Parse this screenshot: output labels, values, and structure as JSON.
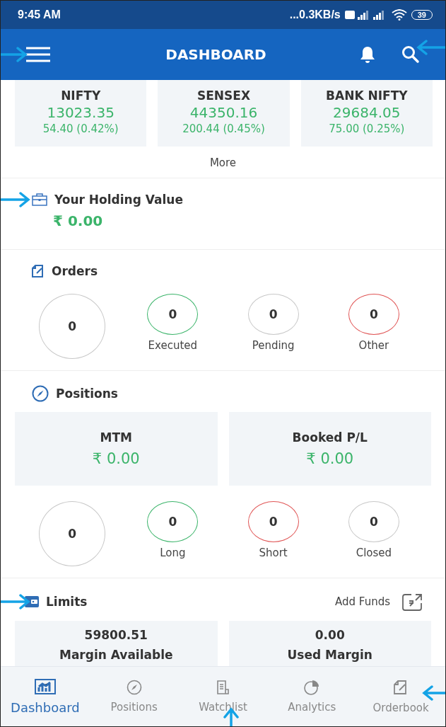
{
  "status_bar": {
    "time": "9:45 AM",
    "speed": "...0.3KB/s",
    "battery": "39"
  },
  "app_bar": {
    "title": "DASHBOARD"
  },
  "indices": [
    {
      "name": "NIFTY",
      "value": "13023.35",
      "change": "54.40  (0.42%)"
    },
    {
      "name": "SENSEX",
      "value": "44350.16",
      "change": "200.44  (0.45%)"
    },
    {
      "name": "BANK NIFTY",
      "value": "29684.05",
      "change": "75.00  (0.25%)"
    }
  ],
  "more_link": "More",
  "holding": {
    "title": "Your Holding Value",
    "value": "₹ 0.00"
  },
  "orders": {
    "title": "Orders",
    "counters": [
      {
        "kind": "total",
        "value": "0",
        "color": "#c8c8c8"
      },
      {
        "kind": "status",
        "value": "0",
        "label": "Executed",
        "color": "#3bb46a"
      },
      {
        "kind": "status",
        "value": "0",
        "label": "Pending",
        "color": "#c8c8c8"
      },
      {
        "kind": "status",
        "value": "0",
        "label": "Other",
        "color": "#e05555"
      }
    ]
  },
  "positions": {
    "title": "Positions",
    "cards": [
      {
        "label": "MTM",
        "value": "₹ 0.00"
      },
      {
        "label": "Booked P/L",
        "value": "₹ 0.00"
      }
    ],
    "counters": [
      {
        "kind": "total",
        "value": "0",
        "color": "#c8c8c8"
      },
      {
        "kind": "status",
        "value": "0",
        "label": "Long",
        "color": "#3bb46a"
      },
      {
        "kind": "status",
        "value": "0",
        "label": "Short",
        "color": "#e05555"
      },
      {
        "kind": "status",
        "value": "0",
        "label": "Closed",
        "color": "#c8c8c8"
      }
    ]
  },
  "limits": {
    "title": "Limits",
    "add_funds": "Add Funds",
    "cards": [
      {
        "value": "59800.51",
        "label": "Margin Available"
      },
      {
        "value": "0.00",
        "label": "Used Margin"
      }
    ]
  },
  "bottom_nav": [
    {
      "label": "Dashboard",
      "selected": true
    },
    {
      "label": "Positions",
      "selected": false
    },
    {
      "label": "Watchlist",
      "selected": false
    },
    {
      "label": "Analytics",
      "selected": false
    },
    {
      "label": "Orderbook",
      "selected": false
    }
  ]
}
